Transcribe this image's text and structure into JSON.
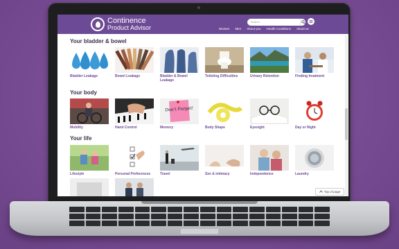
{
  "header": {
    "logo_title": "Continence",
    "logo_subtitle": "Product Advisor",
    "search_placeholder": "Search",
    "nav": [
      "Women",
      "Men",
      "About you",
      "Health Conditions",
      "About us"
    ]
  },
  "sections": [
    {
      "title": "Your bladder & bowel",
      "items": [
        "Bladder Leakage",
        "Bowel Leakage",
        "Bladder & Bowel Leakage",
        "Toileting Difficulties",
        "Urinary Retention",
        "Finding treatment"
      ]
    },
    {
      "title": "Your body",
      "items": [
        "Mobility",
        "Hand Control",
        "Memory",
        "Body Shape",
        "Eyesight",
        "Day or Night"
      ]
    },
    {
      "title": "Your life",
      "items": [
        "Lifestyle",
        "Personal Preferences",
        "Travel",
        "Sex & intimacy",
        "Independence",
        "Laundry"
      ]
    }
  ],
  "memory_note": "Don't Forget!",
  "top_of_page": "Top of page",
  "colors": {
    "brand": "#6d4a95",
    "background": "#7b4f96",
    "heading": "#3b2f4a"
  },
  "icons": [
    "drop-logo-icon",
    "search-icon",
    "menu-icon",
    "chevron-up-icon"
  ]
}
